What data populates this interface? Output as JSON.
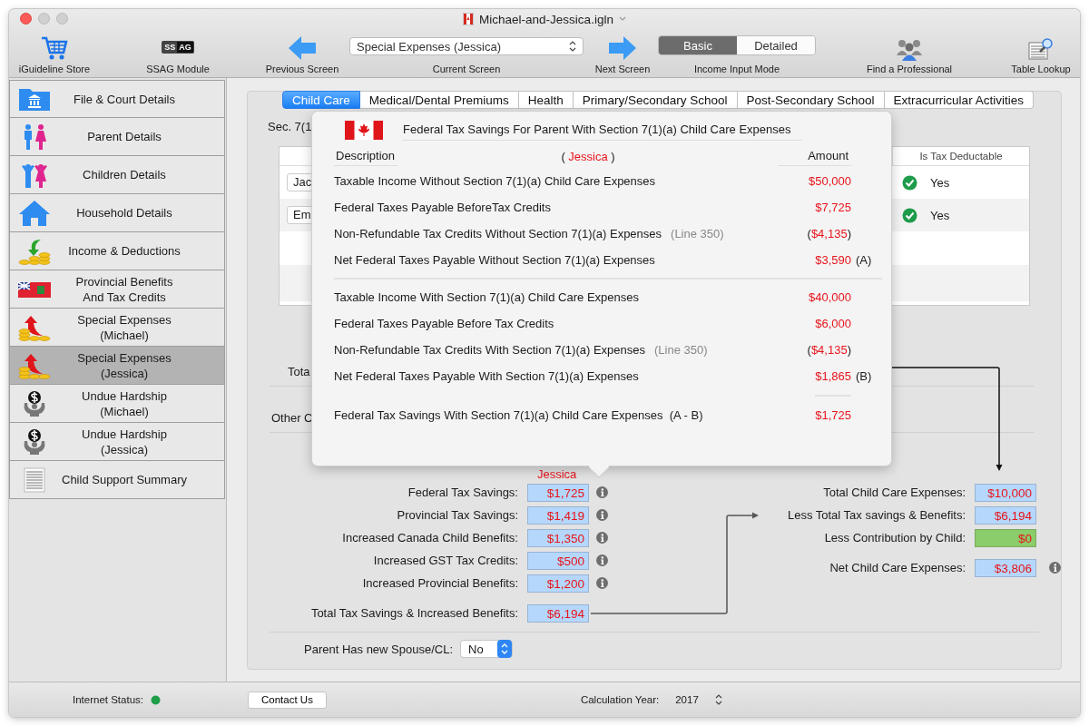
{
  "window": {
    "title": "Michael-and-Jessica.igln"
  },
  "toolbar": {
    "store": {
      "label": "iGuideline Store"
    },
    "ssag": {
      "label": "SSAG Module",
      "badge_left": "SS",
      "badge_right": "AG"
    },
    "previous": {
      "label": "Previous Screen"
    },
    "current": {
      "label": "Current Screen",
      "value": "Special Expenses (Jessica)"
    },
    "next": {
      "label": "Next Screen"
    },
    "income_mode": {
      "label": "Income Input Mode",
      "segments": [
        {
          "label": "Basic",
          "selected": true
        },
        {
          "label": "Detailed",
          "selected": false
        }
      ]
    },
    "professional": {
      "label": "Find a Professional"
    },
    "lookup": {
      "label": "Table Lookup"
    }
  },
  "sidebar": {
    "items": [
      {
        "kind": "folder",
        "lines": [
          "File & Court Details"
        ],
        "selected": false
      },
      {
        "kind": "parents",
        "lines": [
          "Parent Details"
        ],
        "selected": false
      },
      {
        "kind": "children",
        "lines": [
          "Children Details"
        ],
        "selected": false
      },
      {
        "kind": "house",
        "lines": [
          "Household Details"
        ],
        "selected": false
      },
      {
        "kind": "income",
        "lines": [
          "Income & Deductions"
        ],
        "selected": false
      },
      {
        "kind": "flag",
        "lines": [
          "Provincial Benefits",
          "And Tax Credits"
        ],
        "selected": false
      },
      {
        "kind": "expense",
        "lines": [
          "Special Expenses",
          "(Michael)"
        ],
        "selected": false
      },
      {
        "kind": "expense",
        "lines": [
          "Special Expenses",
          "(Jessica)"
        ],
        "selected": true
      },
      {
        "kind": "hardship",
        "lines": [
          "Undue Hardship",
          "(Michael)"
        ],
        "selected": false
      },
      {
        "kind": "hardship",
        "lines": [
          "Undue Hardship",
          "(Jessica)"
        ],
        "selected": false
      },
      {
        "kind": "summary",
        "lines": [
          "Child Support Summary"
        ],
        "selected": false
      }
    ]
  },
  "tabs": [
    {
      "label": "Child Care",
      "selected": true
    },
    {
      "label": "Medical/Dental Premiums",
      "selected": false
    },
    {
      "label": "Health",
      "selected": false
    },
    {
      "label": "Primary/Secondary School",
      "selected": false
    },
    {
      "label": "Post-Secondary School",
      "selected": false
    },
    {
      "label": "Extracurricular Activities",
      "selected": false
    }
  ],
  "background": {
    "section_label": "Sec. 7(1",
    "table": {
      "column": "Is Tax Deductable",
      "rows": [
        {
          "name": "Jac",
          "deductible": "Yes",
          "checked": true
        },
        {
          "name": "Em",
          "deductible": "Yes",
          "checked": true
        }
      ]
    },
    "total_label": "Tota",
    "other_label": "Other C"
  },
  "popover": {
    "title": "Federal Tax Savings For Parent With Section 7(1)(a) Child Care Expenses",
    "description_header": "Description",
    "party_open": "(",
    "party": "Jessica",
    "party_close": ")",
    "amount_header": "Amount",
    "groups": [
      {
        "rows": [
          {
            "label": "Taxable Income Without Section 7(1)(a) Child Care Expenses",
            "amount": "$50,000"
          },
          {
            "label": "Federal Taxes Payable BeforeTax Credits",
            "amount": "$7,725"
          },
          {
            "label": "Non-Refundable Tax Credits Without Section 7(1)(a) Expenses",
            "note": "(Line 350)",
            "open": "(",
            "amount": "$4,135",
            "close": ")"
          },
          {
            "label": "Net Federal Taxes Payable Without Section 7(1)(a) Expenses",
            "amount": "$3,590",
            "tag": "(A)"
          }
        ]
      },
      {
        "rows": [
          {
            "label": "Taxable Income With Section 7(1)(a) Child Care Expenses",
            "amount": "$40,000"
          },
          {
            "label": "Federal Taxes Payable Before Tax Credits",
            "amount": "$6,000"
          },
          {
            "label": "Non-Refundable Tax Credits With Section 7(1)(a) Expenses",
            "note": "(Line 350)",
            "open": "(",
            "amount": "$4,135",
            "close": ")"
          },
          {
            "label": "Net Federal Taxes Payable With Section 7(1)(a) Expenses",
            "amount": "$1,865",
            "tag": "(B)"
          }
        ]
      }
    ],
    "result": {
      "label": "Federal Tax Savings With Section 7(1)(a) Child Care Expenses",
      "formula": "(A - B)",
      "amount": "$1,725"
    }
  },
  "savings": {
    "heading": "Jessica",
    "rows": [
      {
        "label": "Federal Tax Savings:",
        "value": "$1,725",
        "info": true
      },
      {
        "label": "Provincial Tax Savings:",
        "value": "$1,419",
        "info": true
      },
      {
        "label": "Increased Canada Child Benefits:",
        "value": "$1,350",
        "info": true
      },
      {
        "label": "Increased GST Tax Credits:",
        "value": "$500",
        "info": true
      },
      {
        "label": "Increased Provincial Benefits:",
        "value": "$1,200",
        "info": true
      }
    ],
    "total": {
      "label": "Total Tax Savings & Increased Benefits:",
      "value": "$6,194"
    }
  },
  "expenses": {
    "rows": [
      {
        "label": "Total Child Care Expenses:",
        "value": "$10,000",
        "kind": "computed"
      },
      {
        "label": "Less Total Tax savings & Benefits:",
        "value": "$6,194",
        "kind": "computed"
      },
      {
        "label": "Less Contribution by Child:",
        "value": "$0",
        "kind": "input"
      }
    ],
    "net": {
      "label": "Net Child Care Expenses:",
      "value": "$3,806",
      "info": true
    }
  },
  "spouse": {
    "label": "Parent Has new Spouse/CL:",
    "value": "No"
  },
  "status_bar": {
    "internet_label": "Internet Status:",
    "online": true,
    "contact": "Contact Us",
    "year_label": "Calculation Year:",
    "year": "2017"
  }
}
